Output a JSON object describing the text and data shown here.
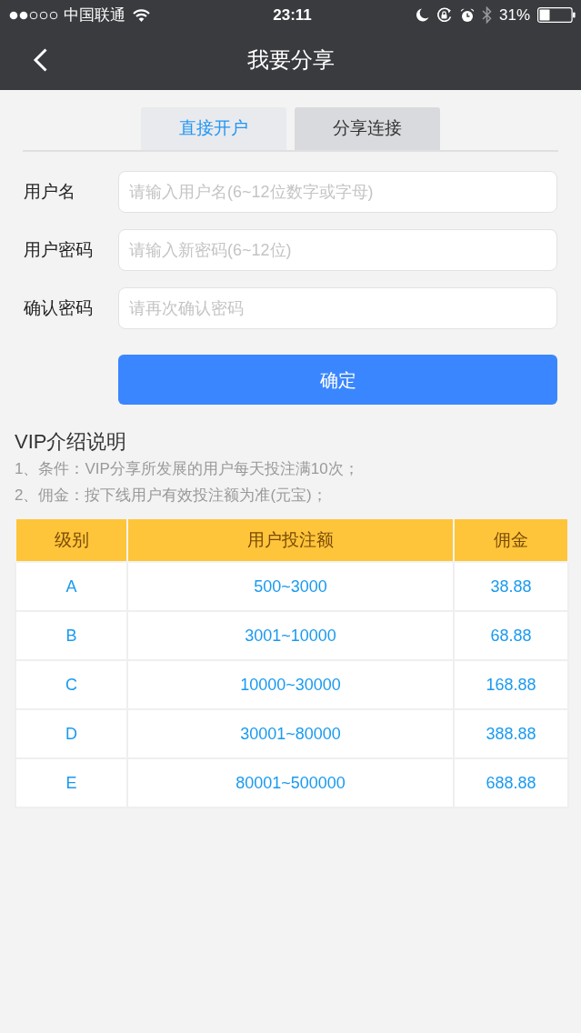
{
  "status_bar": {
    "carrier": "中国联通",
    "time": "23:11",
    "battery": "31%"
  },
  "nav_bar": {
    "title": "我要分享"
  },
  "tabs": [
    {
      "label": "直接开户",
      "selected": true
    },
    {
      "label": "分享连接",
      "selected": false
    }
  ],
  "form": {
    "fields": [
      {
        "label": "用户名",
        "placeholder": "请输入用户名(6~12位数字或字母)"
      },
      {
        "label": "用户密码",
        "placeholder": "请输入新密码(6~12位)"
      },
      {
        "label": "确认密码",
        "placeholder": "请再次确认密码"
      }
    ],
    "submit": "确定"
  },
  "vip_info": {
    "title": "VIP介绍说明",
    "notes": [
      "1、条件：VIP分享所发展的用户每天投注满10次；",
      "2、佣金：按下线用户有效投注额为准(元宝)；"
    ]
  },
  "table": {
    "columns": [
      "级别",
      "用户投注额",
      "佣金"
    ],
    "rows": [
      [
        "A",
        "500~3000",
        "38.88"
      ],
      [
        "B",
        "3001~10000",
        "68.88"
      ],
      [
        "C",
        "10000~30000",
        "168.88"
      ],
      [
        "D",
        "30001~80000",
        "388.88"
      ],
      [
        "E",
        "80001~500000",
        "688.88"
      ]
    ]
  }
}
